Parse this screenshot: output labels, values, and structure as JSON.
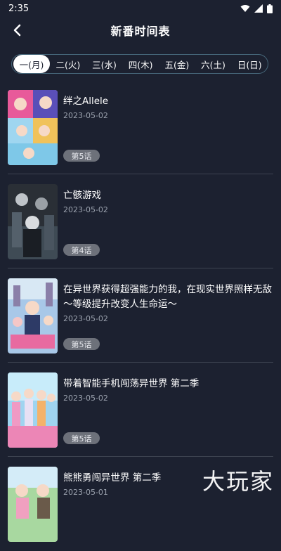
{
  "status": {
    "time": "2:35"
  },
  "nav": {
    "title": "新番时间表"
  },
  "tabs": [
    {
      "label": "一(月)"
    },
    {
      "label": "二(火)"
    },
    {
      "label": "三(水)"
    },
    {
      "label": "四(木)"
    },
    {
      "label": "五(金)"
    },
    {
      "label": "六(土)"
    },
    {
      "label": "日(日)"
    }
  ],
  "items": [
    {
      "title": "绊之Allele",
      "date": "2023-05-02",
      "episode": "第5话"
    },
    {
      "title": "亡骸游戏",
      "date": "2023-05-02",
      "episode": "第4话"
    },
    {
      "title": "在异世界获得超强能力的我，在现实世界照样无敌～等级提升改变人生命运～",
      "date": "2023-05-02",
      "episode": "第5话"
    },
    {
      "title": "带着智能手机闯荡异世界 第二季",
      "date": "2023-05-02",
      "episode": "第5话"
    },
    {
      "title": "熊熊勇闯异世界 第二季",
      "date": "2023-05-01"
    }
  ],
  "watermark": "大玩家",
  "colors": {
    "background": "#1c2130",
    "tab_border": "#46677a",
    "badge": "#6d717a"
  }
}
